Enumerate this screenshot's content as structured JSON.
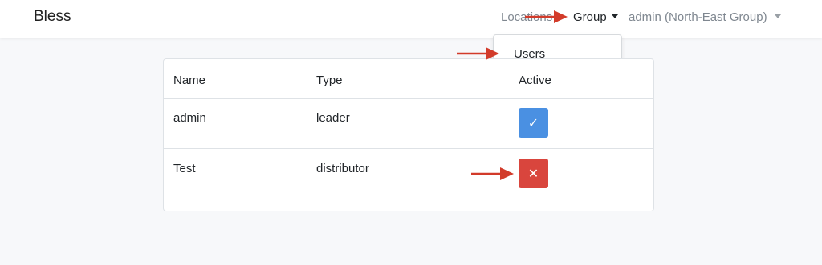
{
  "navbar": {
    "brand": "Bless",
    "links": {
      "locations": "Locations",
      "group": "Group",
      "user": "admin (North-East Group)"
    }
  },
  "dropdown": {
    "items": [
      "Users"
    ]
  },
  "table": {
    "headers": [
      "Name",
      "Type",
      "Active"
    ],
    "rows": [
      {
        "name": "admin",
        "type": "leader",
        "active": true,
        "active_symbol": "✓"
      },
      {
        "name": "Test",
        "type": "distributor",
        "active": false,
        "active_symbol": "✕"
      }
    ]
  },
  "colors": {
    "active_button": "#4a90e2",
    "inactive_button": "#d9453d",
    "annotation_arrow": "#d23b2a"
  },
  "annotations": {
    "arrow_icon": "right-arrow-icon"
  }
}
